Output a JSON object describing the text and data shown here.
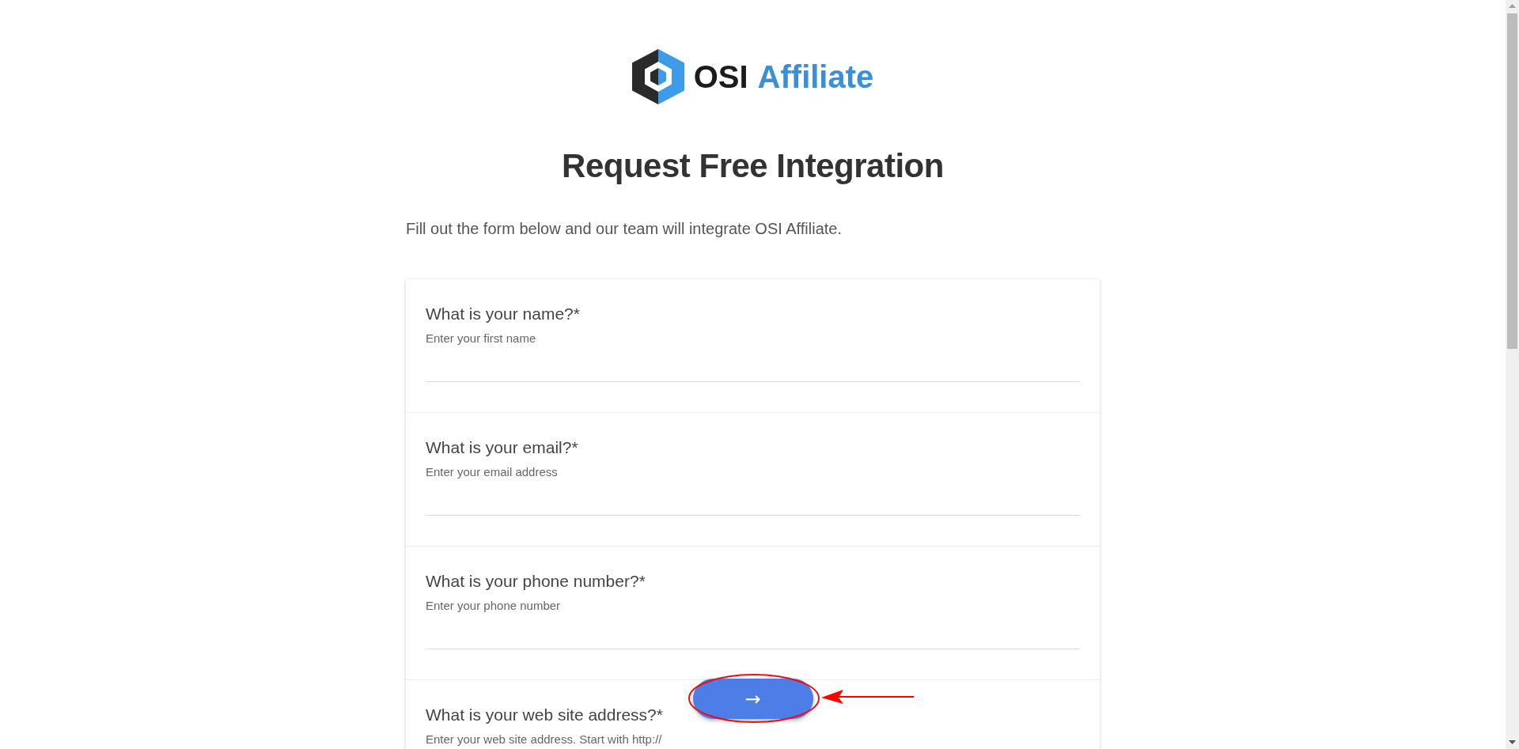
{
  "logo": {
    "brand": "OSI",
    "product": "Affiliate"
  },
  "title": "Request Free Integration",
  "intro": "Fill out the form below and our team will integrate OSI Affiliate.",
  "questions": [
    {
      "label": "What is your name?*",
      "placeholder": "Enter your first name"
    },
    {
      "label": "What is your email?*",
      "placeholder": "Enter your email address"
    },
    {
      "label": "What is your phone number?*",
      "placeholder": "Enter your phone number"
    },
    {
      "label": "What is your web site address?*",
      "placeholder": "Enter your web site address. Start with http://"
    }
  ],
  "next_button": {
    "label": "→"
  }
}
